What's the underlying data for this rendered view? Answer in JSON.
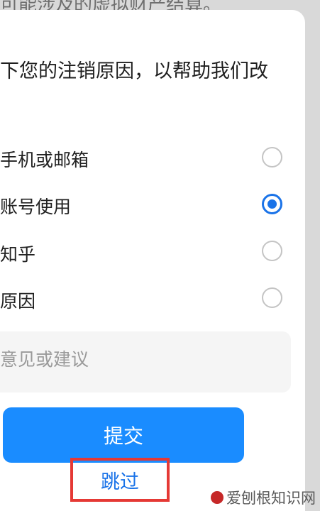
{
  "background": {
    "text": "可能涉及的虚拟财产结算。"
  },
  "dialog": {
    "heading": "下您的注销原因，以帮助我们改",
    "options": [
      {
        "label": "手机或邮箱",
        "selected": false
      },
      {
        "label": "账号使用",
        "selected": true
      },
      {
        "label": "知乎",
        "selected": false
      },
      {
        "label": "原因",
        "selected": false
      }
    ],
    "feedback_placeholder": "意见或建议",
    "submit_label": "提交",
    "skip_label": "跳过"
  },
  "watermark": {
    "text": "爱刨根知识网"
  },
  "colors": {
    "accent": "#1a8cff",
    "highlight_box": "#e53935"
  }
}
